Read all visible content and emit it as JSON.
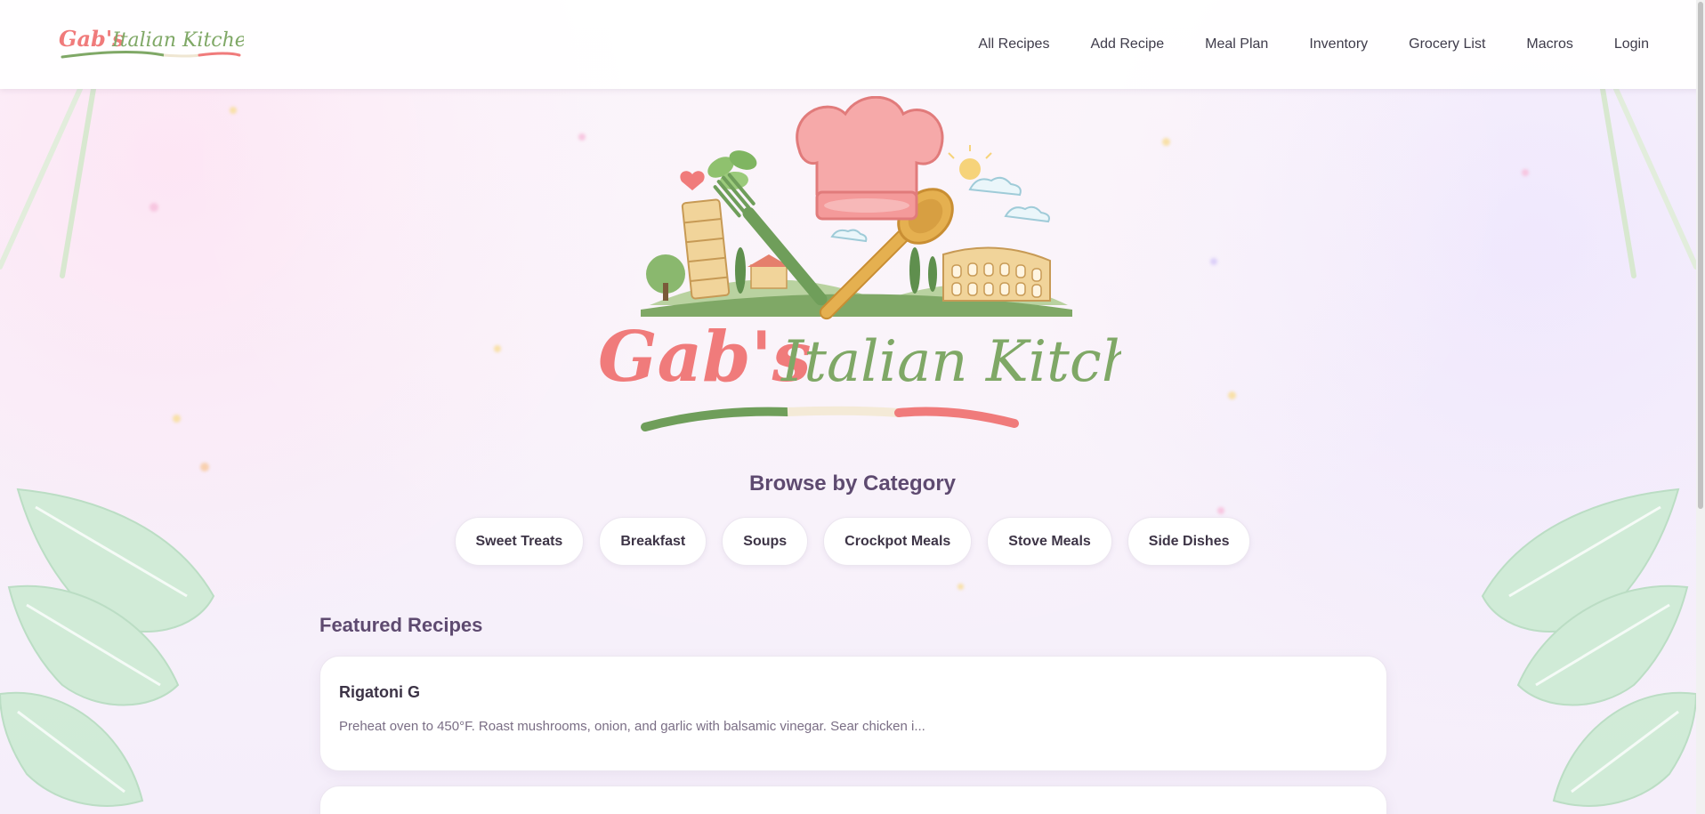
{
  "brand": {
    "name_part1": "Gab's",
    "name_part2": "Italian Kitchen",
    "colors": {
      "pink": "#f07b7b",
      "green": "#7fa866",
      "cream": "#f5ecd6"
    }
  },
  "nav": {
    "items": [
      {
        "label": "All Recipes"
      },
      {
        "label": "Add Recipe"
      },
      {
        "label": "Meal Plan"
      },
      {
        "label": "Inventory"
      },
      {
        "label": "Grocery List"
      },
      {
        "label": "Macros"
      },
      {
        "label": "Login"
      }
    ]
  },
  "hero": {
    "logo_part1": "Gab's",
    "logo_part2": "Italian Kitchen"
  },
  "categories": {
    "title": "Browse by Category",
    "items": [
      {
        "label": "Sweet Treats"
      },
      {
        "label": "Breakfast"
      },
      {
        "label": "Soups"
      },
      {
        "label": "Crockpot Meals"
      },
      {
        "label": "Stove Meals"
      },
      {
        "label": "Side Dishes"
      }
    ]
  },
  "featured": {
    "title": "Featured Recipes",
    "recipes": [
      {
        "title": "Rigatoni G",
        "description": "Preheat oven to 450°F. Roast mushrooms, onion, and garlic with balsamic vinegar. Sear chicken i..."
      }
    ]
  }
}
